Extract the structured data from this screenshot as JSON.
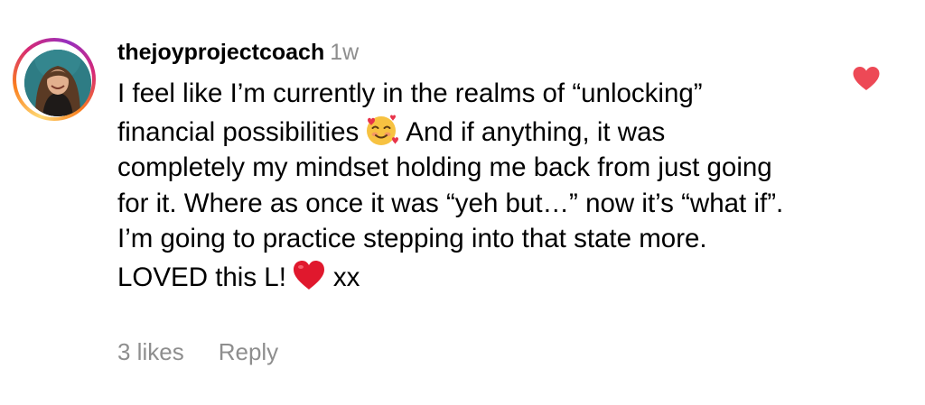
{
  "comment": {
    "username": "thejoyprojectcoach",
    "time_ago": "1w",
    "avatar_icon": "profile-photo",
    "text_part1": "I feel like I’m currently in the realms of “unlocking” financial possibilities",
    "emoji_1": "smiling-face-with-hearts",
    "text_part2": "And if anything, it was completely my mindset holding me back from just going for it. Where as once it was “yeh but…” now it’s “what if”. I’m going to practice stepping into that state more. LOVED this L!",
    "emoji_2": "red-heart",
    "text_part3": "xx",
    "likes_label": "3 likes",
    "reply_label": "Reply",
    "liked": true,
    "like_icon": "heart-filled-icon",
    "like_color": "#ed4956"
  },
  "colors": {
    "text": "#000000",
    "secondary_text": "#8e8e8e",
    "background": "#ffffff"
  }
}
